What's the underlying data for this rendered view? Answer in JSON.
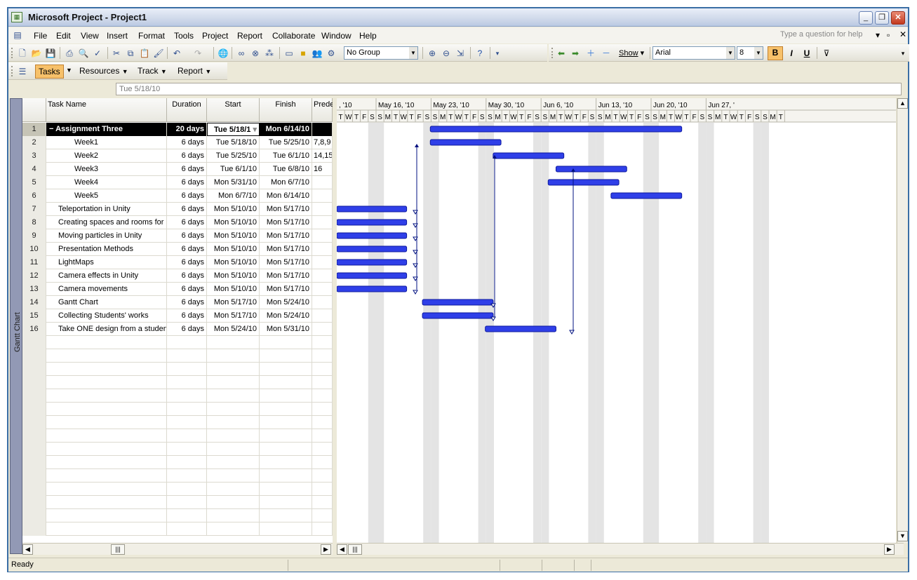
{
  "window": {
    "title": "Microsoft Project - Project1"
  },
  "menu": [
    "File",
    "Edit",
    "View",
    "Insert",
    "Format",
    "Tools",
    "Project",
    "Report",
    "Collaborate",
    "Window",
    "Help"
  ],
  "help_placeholder": "Type a question for help",
  "toolbar": {
    "group": "No Group",
    "show": "Show",
    "font": "Arial",
    "size": "8",
    "bold": "B",
    "italic": "I",
    "underline": "U"
  },
  "guide": {
    "tasks": "Tasks",
    "resources": "Resources",
    "track": "Track",
    "report": "Report"
  },
  "entry_value": "Tue 5/18/10",
  "view_label": "Gantt Chart",
  "columns": [
    "Task Name",
    "Duration",
    "Start",
    "Finish",
    "Prede"
  ],
  "rows": [
    {
      "id": "1",
      "name": "Assignment Three",
      "duration": "20 days",
      "start": "Tue 5/18/1",
      "finish": "Mon 6/14/10",
      "pred": ""
    },
    {
      "id": "2",
      "name": "Week1",
      "duration": "6 days",
      "start": "Tue 5/18/10",
      "finish": "Tue 5/25/10",
      "pred": "7,8,9"
    },
    {
      "id": "3",
      "name": "Week2",
      "duration": "6 days",
      "start": "Tue 5/25/10",
      "finish": "Tue 6/1/10",
      "pred": "14,15"
    },
    {
      "id": "4",
      "name": "Week3",
      "duration": "6 days",
      "start": "Tue 6/1/10",
      "finish": "Tue 6/8/10",
      "pred": "16"
    },
    {
      "id": "5",
      "name": "Week4",
      "duration": "6 days",
      "start": "Mon 5/31/10",
      "finish": "Mon 6/7/10",
      "pred": ""
    },
    {
      "id": "6",
      "name": "Week5",
      "duration": "6 days",
      "start": "Mon 6/7/10",
      "finish": "Mon 6/14/10",
      "pred": ""
    },
    {
      "id": "7",
      "name": "Teleportation in Unity",
      "duration": "6 days",
      "start": "Mon 5/10/10",
      "finish": "Mon 5/17/10",
      "pred": ""
    },
    {
      "id": "8",
      "name": "Creating spaces and rooms for",
      "duration": "6 days",
      "start": "Mon 5/10/10",
      "finish": "Mon 5/17/10",
      "pred": ""
    },
    {
      "id": "9",
      "name": "Moving particles in Unity",
      "duration": "6 days",
      "start": "Mon 5/10/10",
      "finish": "Mon 5/17/10",
      "pred": ""
    },
    {
      "id": "10",
      "name": "Presentation Methods",
      "duration": "6 days",
      "start": "Mon 5/10/10",
      "finish": "Mon 5/17/10",
      "pred": ""
    },
    {
      "id": "11",
      "name": "LightMaps",
      "duration": "6 days",
      "start": "Mon 5/10/10",
      "finish": "Mon 5/17/10",
      "pred": ""
    },
    {
      "id": "12",
      "name": "Camera effects in Unity",
      "duration": "6 days",
      "start": "Mon 5/10/10",
      "finish": "Mon 5/17/10",
      "pred": ""
    },
    {
      "id": "13",
      "name": "Camera movements",
      "duration": "6 days",
      "start": "Mon 5/10/10",
      "finish": "Mon 5/17/10",
      "pred": ""
    },
    {
      "id": "14",
      "name": "Gantt Chart",
      "duration": "6 days",
      "start": "Mon 5/17/10",
      "finish": "Mon 5/24/10",
      "pred": ""
    },
    {
      "id": "15",
      "name": "Collecting Students' works",
      "duration": "6 days",
      "start": "Mon 5/17/10",
      "finish": "Mon 5/24/10",
      "pred": ""
    },
    {
      "id": "16",
      "name": "Take ONE design from a studen",
      "duration": "6 days",
      "start": "Mon 5/24/10",
      "finish": "Mon 5/31/10",
      "pred": ""
    }
  ],
  "timescale": {
    "weeks": [
      ", '10",
      "May 16, '10",
      "May 23, '10",
      "May 30, '10",
      "Jun 6, '10",
      "Jun 13, '10",
      "Jun 20, '10",
      "Jun 27, '"
    ],
    "days": [
      "T",
      "W",
      "T",
      "F",
      "S",
      "S",
      "M",
      "T",
      "W",
      "T",
      "F",
      "S",
      "S",
      "M",
      "T",
      "W",
      "T",
      "F",
      "S",
      "S",
      "M",
      "T",
      "W",
      "T",
      "F",
      "S",
      "S",
      "M",
      "T",
      "W",
      "T",
      "F",
      "S",
      "S",
      "M",
      "T",
      "W",
      "T",
      "F",
      "S",
      "S",
      "M",
      "T",
      "W",
      "T",
      "F",
      "S",
      "S",
      "M",
      "T",
      "W",
      "T",
      "F",
      "S",
      "S",
      "M",
      "T"
    ]
  },
  "bars": [
    {
      "row": 0,
      "start": 8,
      "dur": 32
    },
    {
      "row": 1,
      "start": 8,
      "dur": 9
    },
    {
      "row": 2,
      "start": 16,
      "dur": 9
    },
    {
      "row": 3,
      "start": 24,
      "dur": 9
    },
    {
      "row": 4,
      "start": 23,
      "dur": 9
    },
    {
      "row": 5,
      "start": 31,
      "dur": 9
    },
    {
      "row": 6,
      "start": 0,
      "dur": 8
    },
    {
      "row": 7,
      "start": 0,
      "dur": 8
    },
    {
      "row": 8,
      "start": 0,
      "dur": 8
    },
    {
      "row": 9,
      "start": 0,
      "dur": 8
    },
    {
      "row": 10,
      "start": 0,
      "dur": 8
    },
    {
      "row": 11,
      "start": 0,
      "dur": 8
    },
    {
      "row": 12,
      "start": 0,
      "dur": 8
    },
    {
      "row": 13,
      "start": 7,
      "dur": 9
    },
    {
      "row": 14,
      "start": 7,
      "dur": 9
    },
    {
      "row": 15,
      "start": 15,
      "dur": 9
    }
  ],
  "colors": {
    "bar": "#2f3fe8",
    "bar_edge": "#0e1a9e",
    "nonworking": "#e4e4e4"
  },
  "status": "Ready"
}
